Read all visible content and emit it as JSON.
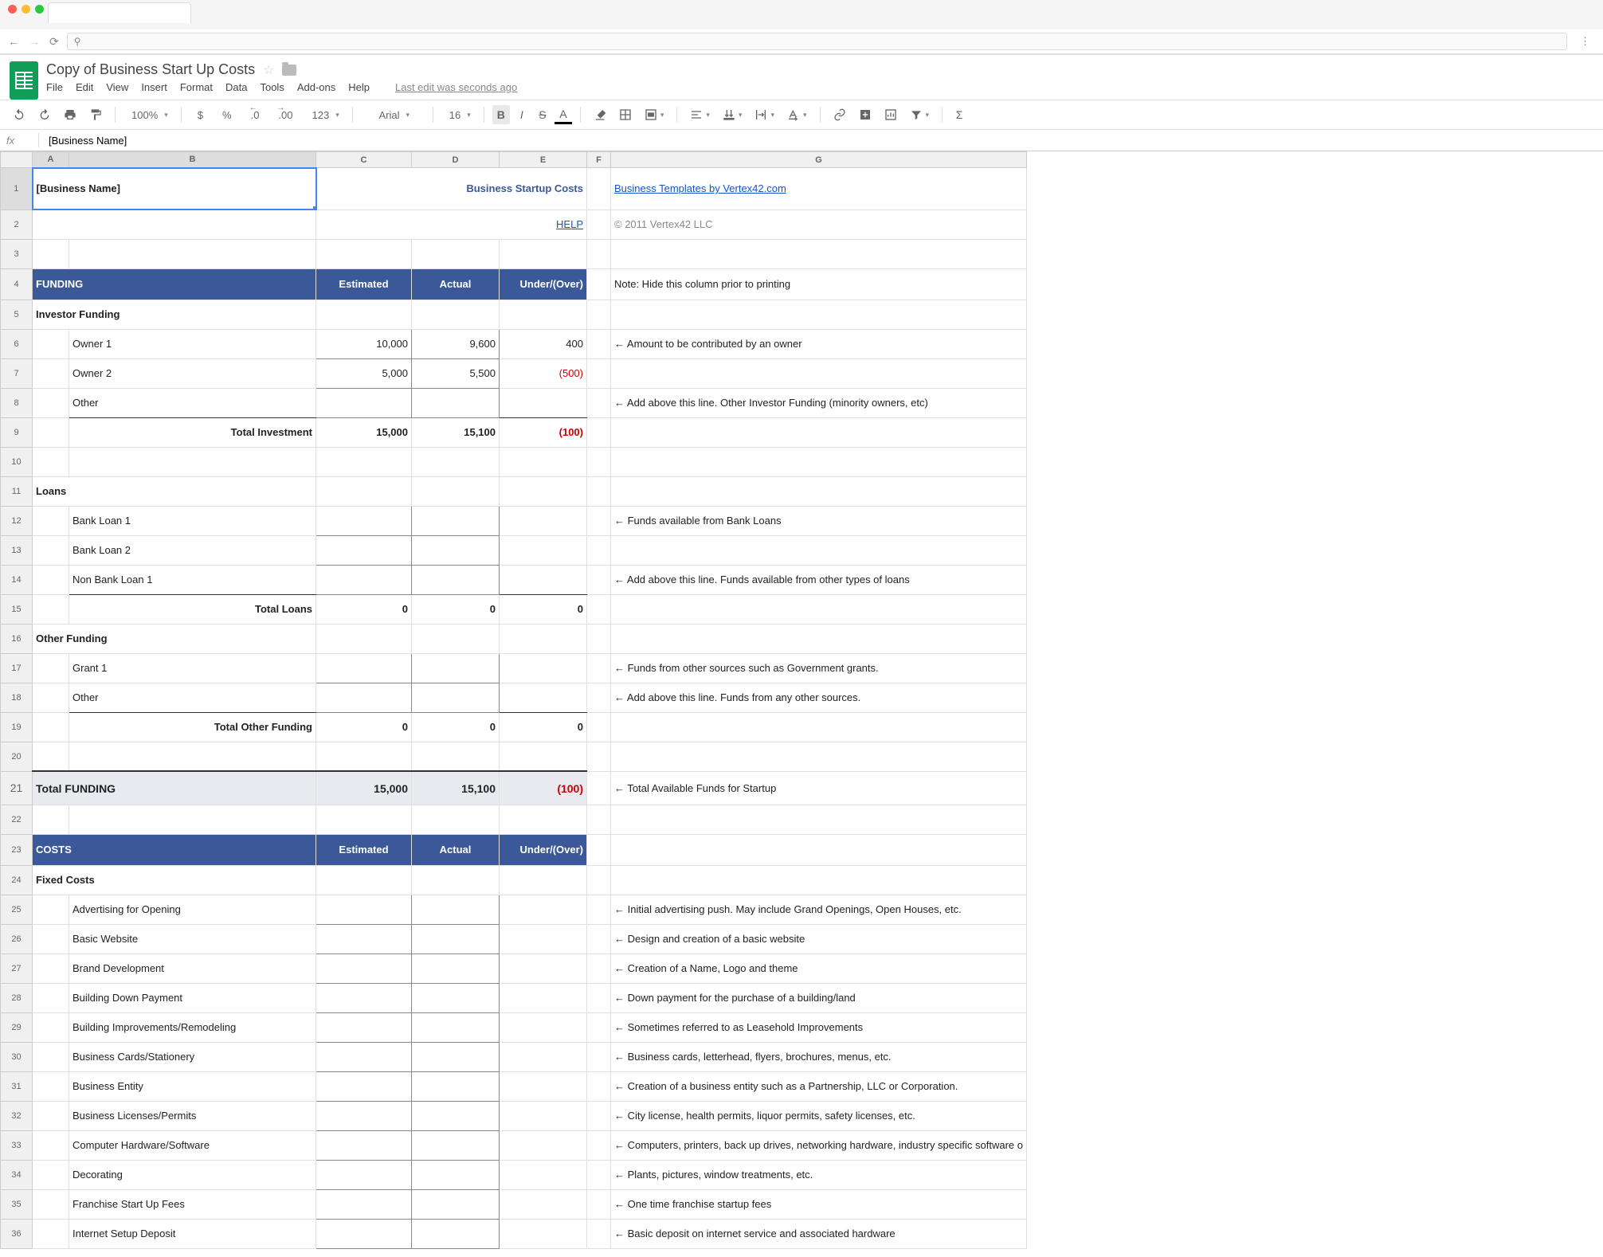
{
  "browser": {
    "url_placeholder": "Search"
  },
  "doc": {
    "title": "Copy of Business Start Up Costs",
    "last_edit": "Last edit was seconds ago"
  },
  "menu": [
    "File",
    "Edit",
    "View",
    "Insert",
    "Format",
    "Data",
    "Tools",
    "Add-ons",
    "Help"
  ],
  "toolbar": {
    "zoom": "100%",
    "currency": "$",
    "percent": "%",
    "dec_minus": ".0",
    "dec_plus": ".00",
    "format_123": "123",
    "font": "Arial",
    "size": "16"
  },
  "formula": {
    "fx": "fx",
    "value": "[Business Name]"
  },
  "columns": [
    "A",
    "B",
    "C",
    "D",
    "E",
    "F",
    "G"
  ],
  "sheet": {
    "a1": "[Business Name]",
    "title": "Business Startup Costs",
    "templates_link": "Business Templates by Vertex42.com",
    "help": "HELP",
    "copyright": "© 2011 Vertex42 LLC",
    "note_print": "Note: Hide this column prior to printing",
    "funding": {
      "header": "FUNDING",
      "est": "Estimated",
      "act": "Actual",
      "under": "Under/(Over)",
      "investor": "Investor Funding",
      "owner1": {
        "label": "Owner 1",
        "est": "10,000",
        "act": "9,600",
        "diff": "400",
        "note": "← Amount to be contributed by an owner"
      },
      "owner2": {
        "label": "Owner 2",
        "est": "5,000",
        "act": "5,500",
        "diff": "(500)"
      },
      "other_inv": {
        "label": "Other",
        "note": "← Add above this line. Other Investor Funding (minority owners, etc)"
      },
      "total_inv": {
        "label": "Total Investment",
        "est": "15,000",
        "act": "15,100",
        "diff": "(100)"
      },
      "loans": "Loans",
      "bank1": {
        "label": "Bank Loan 1",
        "note": "← Funds available from Bank Loans"
      },
      "bank2": {
        "label": "Bank Loan 2"
      },
      "nonbank": {
        "label": "Non Bank Loan 1",
        "note": "← Add above this line. Funds available from other types of loans"
      },
      "total_loans": {
        "label": "Total Loans",
        "est": "0",
        "act": "0",
        "diff": "0"
      },
      "other_funding": "Other Funding",
      "grant1": {
        "label": "Grant 1",
        "note": "← Funds from other sources such as Government grants."
      },
      "other_of": {
        "label": "Other",
        "note": "← Add above this line. Funds from any other sources."
      },
      "total_other": {
        "label": "Total Other Funding",
        "est": "0",
        "act": "0",
        "diff": "0"
      },
      "total_funding": {
        "label": "Total FUNDING",
        "est": "15,000",
        "act": "15,100",
        "diff": "(100)",
        "note": "← Total Available Funds for Startup"
      }
    },
    "costs": {
      "header": "COSTS",
      "est": "Estimated",
      "act": "Actual",
      "under": "Under/(Over)",
      "fixed": "Fixed Costs",
      "items": [
        {
          "label": "Advertising for Opening",
          "note": "← Initial advertising push.  May include Grand Openings, Open Houses, etc."
        },
        {
          "label": "Basic Website",
          "note": "← Design and creation of a basic website"
        },
        {
          "label": "Brand Development",
          "note": "← Creation of a Name, Logo and theme"
        },
        {
          "label": "Building Down Payment",
          "note": "← Down payment for the purchase of a building/land"
        },
        {
          "label": "Building Improvements/Remodeling",
          "note": "← Sometimes referred to as Leasehold Improvements"
        },
        {
          "label": "Business Cards/Stationery",
          "note": "← Business cards, letterhead, flyers, brochures, menus, etc."
        },
        {
          "label": "Business Entity",
          "note": "← Creation of a business entity such as a Partnership, LLC or Corporation."
        },
        {
          "label": "Business Licenses/Permits",
          "note": "← City license, health permits, liquor permits, safety licenses, etc."
        },
        {
          "label": "Computer Hardware/Software",
          "note": "← Computers, printers, back up drives, networking hardware, industry specific software o"
        },
        {
          "label": "Decorating",
          "note": "← Plants, pictures, window treatments, etc."
        },
        {
          "label": "Franchise Start Up Fees",
          "note": "← One time franchise startup fees"
        },
        {
          "label": "Internet Setup Deposit",
          "note": "← Basic deposit on internet service and associated hardware"
        }
      ]
    }
  }
}
